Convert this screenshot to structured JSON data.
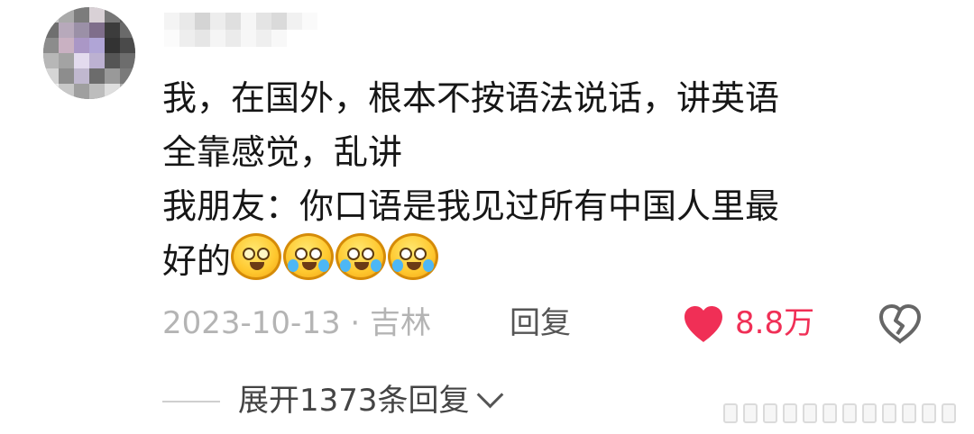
{
  "comment": {
    "author": "",
    "text_lines": [
      "我，在国外，根本不按语法说话，讲英语",
      "全靠感觉，乱讲",
      "我朋友：你口语是我见过所有中国人里最",
      "好的"
    ],
    "emojis": [
      "starry-eyes-emoji",
      "crying-laughing-emoji",
      "crying-laughing-emoji",
      "crying-laughing-emoji"
    ]
  },
  "meta": {
    "date_location": "2023-10-13 · 吉林",
    "reply_label": "回复",
    "like_count": "8.8万",
    "liked": true,
    "like_color": "#f02f56"
  },
  "replies": {
    "expand_label": "展开1373条回复"
  },
  "icons": {
    "like": "heart-icon",
    "dislike": "broken-heart-icon",
    "expand": "chevron-down-icon"
  }
}
